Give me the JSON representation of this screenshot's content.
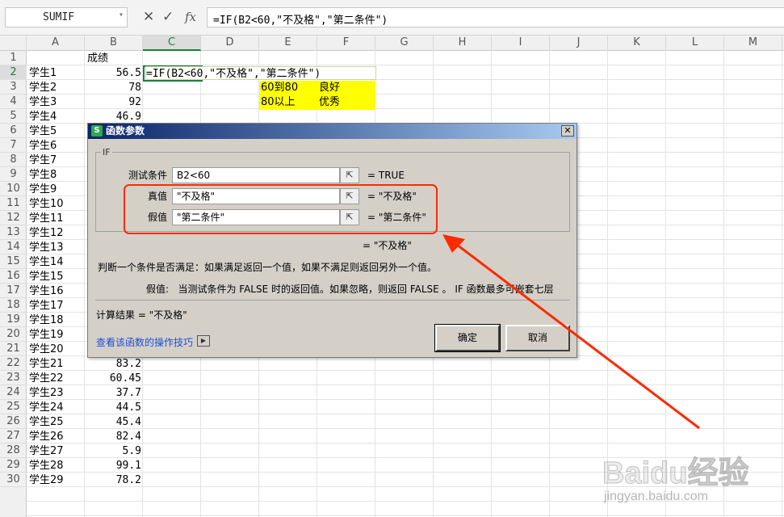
{
  "formula_bar": {
    "name_box": "SUMIF",
    "cancel_icon": "✕",
    "enter_icon": "✓",
    "fx_label": "fx",
    "formula": "=IF(B2<60,\"不及格\",\"第二条件\")"
  },
  "columns": [
    "A",
    "B",
    "C",
    "D",
    "E",
    "F",
    "G",
    "H",
    "I",
    "J",
    "K",
    "L",
    "M"
  ],
  "rows": [
    "1",
    "2",
    "3",
    "4",
    "5",
    "6",
    "7",
    "8",
    "9",
    "10",
    "11",
    "12",
    "13",
    "14",
    "15",
    "16",
    "17",
    "18",
    "19",
    "20",
    "21",
    "22",
    "23",
    "24",
    "25",
    "26",
    "27",
    "28",
    "29",
    "30"
  ],
  "cells": {
    "b1": "成绩",
    "c2_formula": "=IF(B2<60,\"不及格\",\"第二条件\")",
    "e3": "60到80",
    "f3": "良好",
    "e4": "80以上",
    "f4": "优秀"
  },
  "students": [
    {
      "name": "学生1",
      "score": "56.5"
    },
    {
      "name": "学生2",
      "score": "78"
    },
    {
      "name": "学生3",
      "score": "92"
    },
    {
      "name": "学生4",
      "score": "46.9"
    },
    {
      "name": "学生5",
      "score": ""
    },
    {
      "name": "学生6",
      "score": ""
    },
    {
      "name": "学生7",
      "score": ""
    },
    {
      "name": "学生8",
      "score": ""
    },
    {
      "name": "学生9",
      "score": ""
    },
    {
      "name": "学生10",
      "score": ""
    },
    {
      "name": "学生11",
      "score": ""
    },
    {
      "name": "学生12",
      "score": ""
    },
    {
      "name": "学生13",
      "score": ""
    },
    {
      "name": "学生14",
      "score": ""
    },
    {
      "name": "学生15",
      "score": ""
    },
    {
      "name": "学生16",
      "score": ""
    },
    {
      "name": "学生17",
      "score": ""
    },
    {
      "name": "学生18",
      "score": ""
    },
    {
      "name": "学生19",
      "score": ""
    },
    {
      "name": "学生20",
      "score": ""
    },
    {
      "name": "学生21",
      "score": "83.2"
    },
    {
      "name": "学生22",
      "score": "60.45"
    },
    {
      "name": "学生23",
      "score": "37.7"
    },
    {
      "name": "学生24",
      "score": "44.5"
    },
    {
      "name": "学生25",
      "score": "45.4"
    },
    {
      "name": "学生26",
      "score": "82.4"
    },
    {
      "name": "学生27",
      "score": "5.9"
    },
    {
      "name": "学生28",
      "score": "99.1"
    },
    {
      "name": "学生29",
      "score": "78.2"
    }
  ],
  "dialog": {
    "logo": "S",
    "title": "函数参数",
    "close": "✕",
    "group_label": "IF",
    "args": [
      {
        "label": "测试条件",
        "value": "B2<60",
        "result": "=  TRUE"
      },
      {
        "label": "真值",
        "value": "\"不及格\"",
        "result": "=  \"不及格\""
      },
      {
        "label": "假值",
        "value": "\"第二条件\"",
        "result": "=  \"第二条件\""
      }
    ],
    "pick_icon": "⇱",
    "overall_result": "=  \"不及格\"",
    "description": "判断一个条件是否满足：如果满足返回一个值，如果不满足则返回另外一个值。",
    "arg_help": "假值:   当测试条件为 FALSE 时的返回值。如果忽略，则返回 FALSE 。 IF 函数最多可嵌套七层",
    "calc_result": "计算结果 =  \"不及格\"",
    "help_link": "查看该函数的操作技巧",
    "ok": "确定",
    "cancel": "取消"
  },
  "annotation_color": "#ff2a00",
  "watermark": {
    "text": "Baidu经验",
    "sub": "jingyan.baidu.com"
  }
}
